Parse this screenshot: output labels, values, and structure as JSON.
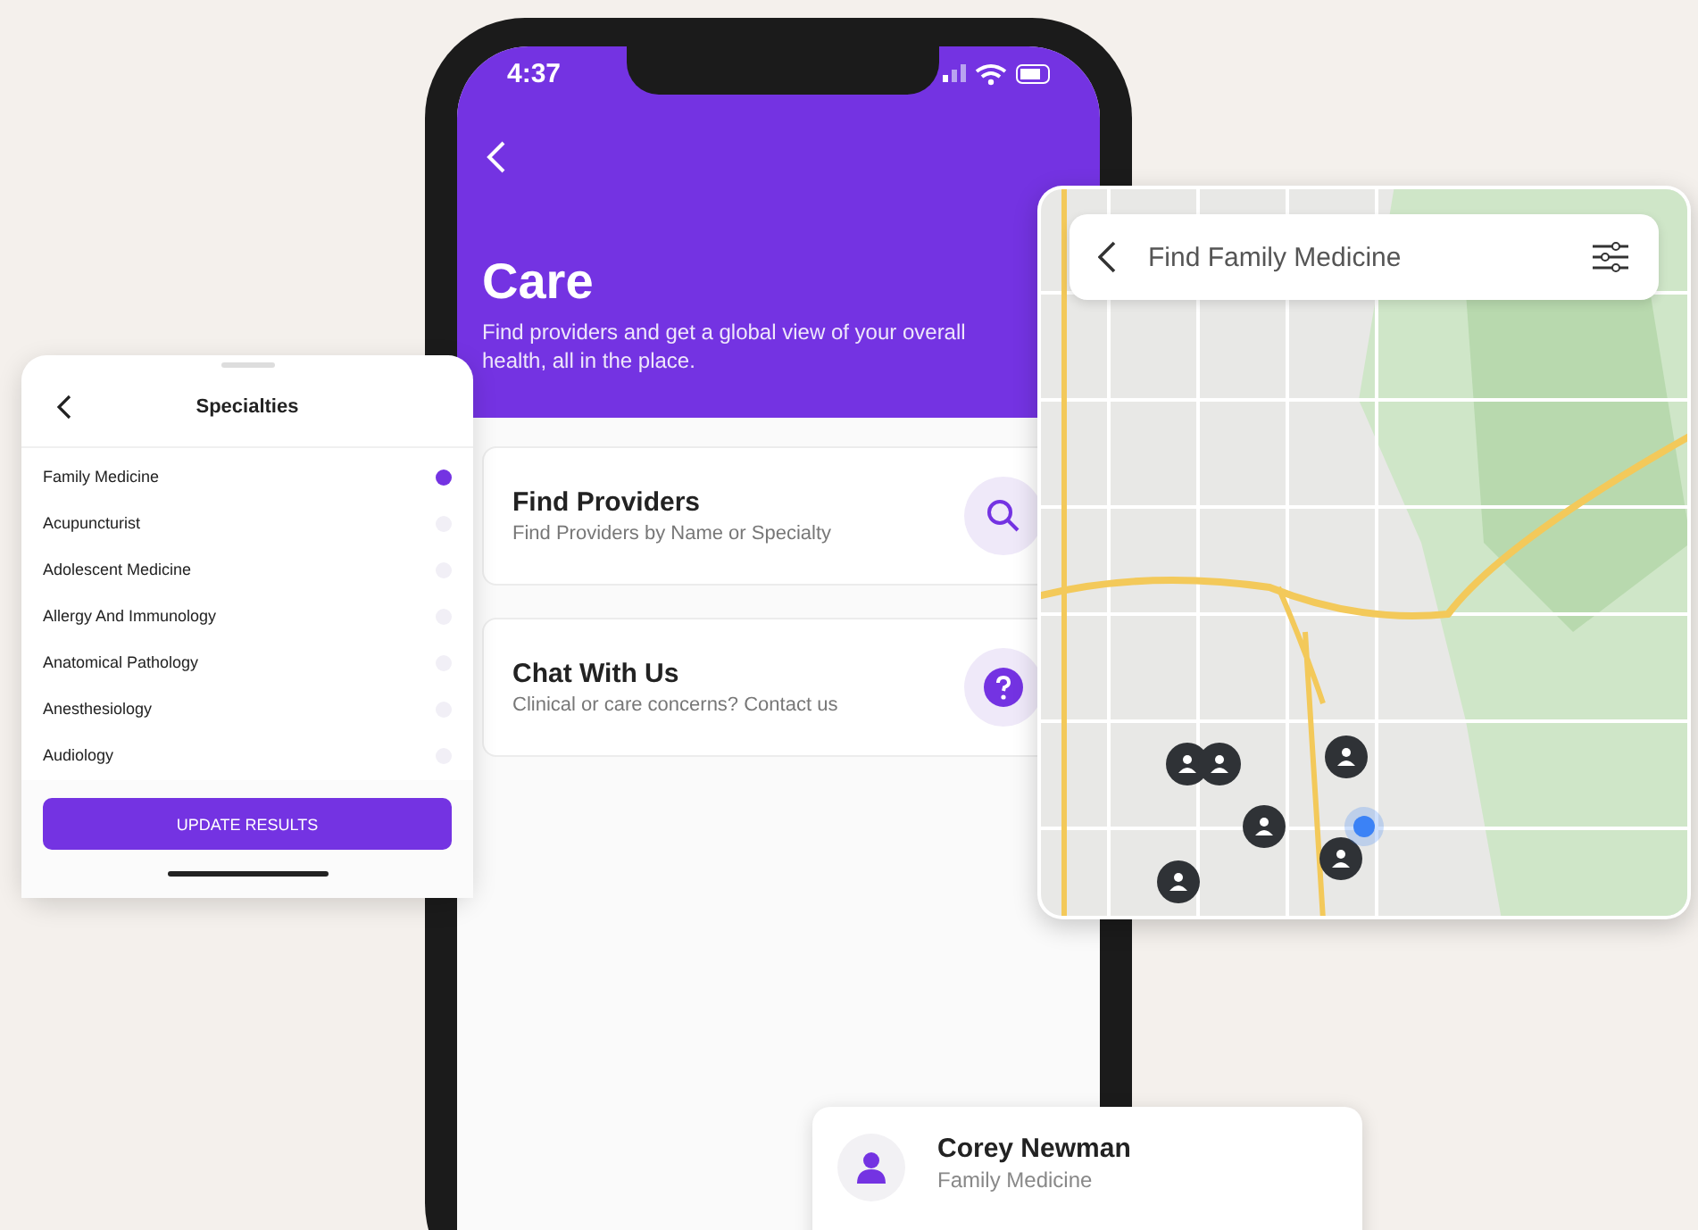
{
  "phone": {
    "status_bar": {
      "time": "4:37"
    },
    "header": {
      "title": "Care",
      "subtitle": "Find providers and get a global view of your overall health, all in the place."
    },
    "options": [
      {
        "kind": "search",
        "title": "Find Providers",
        "subtitle": "Find Providers by Name or Specialty"
      },
      {
        "kind": "help",
        "title": "Chat With Us",
        "subtitle": "Clinical or care concerns? Contact us"
      }
    ]
  },
  "specialties_sheet": {
    "title": "Specialties",
    "items": [
      {
        "label": "Family Medicine",
        "selected": true
      },
      {
        "label": "Acupuncturist",
        "selected": false
      },
      {
        "label": "Adolescent Medicine",
        "selected": false
      },
      {
        "label": "Allergy And Immunology",
        "selected": false
      },
      {
        "label": "Anatomical Pathology",
        "selected": false
      },
      {
        "label": "Anesthesiology",
        "selected": false
      },
      {
        "label": "Audiology",
        "selected": false
      }
    ],
    "button": "UPDATE RESULTS"
  },
  "map_card": {
    "title": "Find Family Medicine"
  },
  "provider_card": {
    "name": "Corey Newman",
    "specialty": "Family Medicine"
  }
}
